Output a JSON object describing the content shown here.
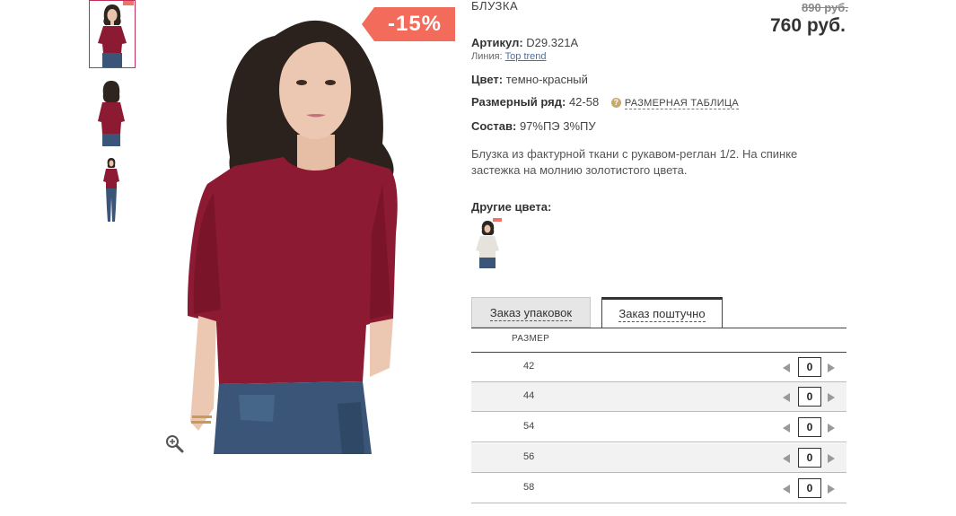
{
  "product": {
    "category": "БЛУЗКА",
    "old_price": "890 руб.",
    "new_price": "760 руб.",
    "discount": "-15%",
    "article_label": "Артикул:",
    "article_value": "D29.321A",
    "line_label": "Линия:",
    "line_value": "Top trend",
    "color_label": "Цвет:",
    "color_value": "темно-красный",
    "size_range_label": "Размерный ряд:",
    "size_range_value": "42-58",
    "size_table_link": "РАЗМЕРНАЯ ТАБЛИЦА",
    "composition_label": "Состав:",
    "composition_value": "97%ПЭ 3%ПУ",
    "description": "Блузка из фактурной ткани с рукавом-реглан 1/2. На спинке застежка на молнию золотистого цвета.",
    "other_colors_label": "Другие цвета:"
  },
  "colors": {
    "blouse": "#8b1a32",
    "jeans": "#3a5578",
    "discount_badge": "#f26b5b",
    "thumb_active_border": "#c2305a",
    "link": "#4a6fae",
    "help_icon": "#c9a96a"
  },
  "icons": {
    "zoom": "zoom-in-icon",
    "help": "help-icon",
    "decrease": "arrow-left-icon",
    "increase": "arrow-right-icon"
  },
  "tabs": [
    {
      "label": "Заказ упаковок",
      "active": false
    },
    {
      "label": "Заказ поштучно",
      "active": true
    }
  ],
  "size_table": {
    "header": "РАЗМЕР",
    "rows": [
      {
        "size": "42",
        "qty": "0"
      },
      {
        "size": "44",
        "qty": "0"
      },
      {
        "size": "54",
        "qty": "0"
      },
      {
        "size": "56",
        "qty": "0"
      },
      {
        "size": "58",
        "qty": "0"
      }
    ]
  }
}
